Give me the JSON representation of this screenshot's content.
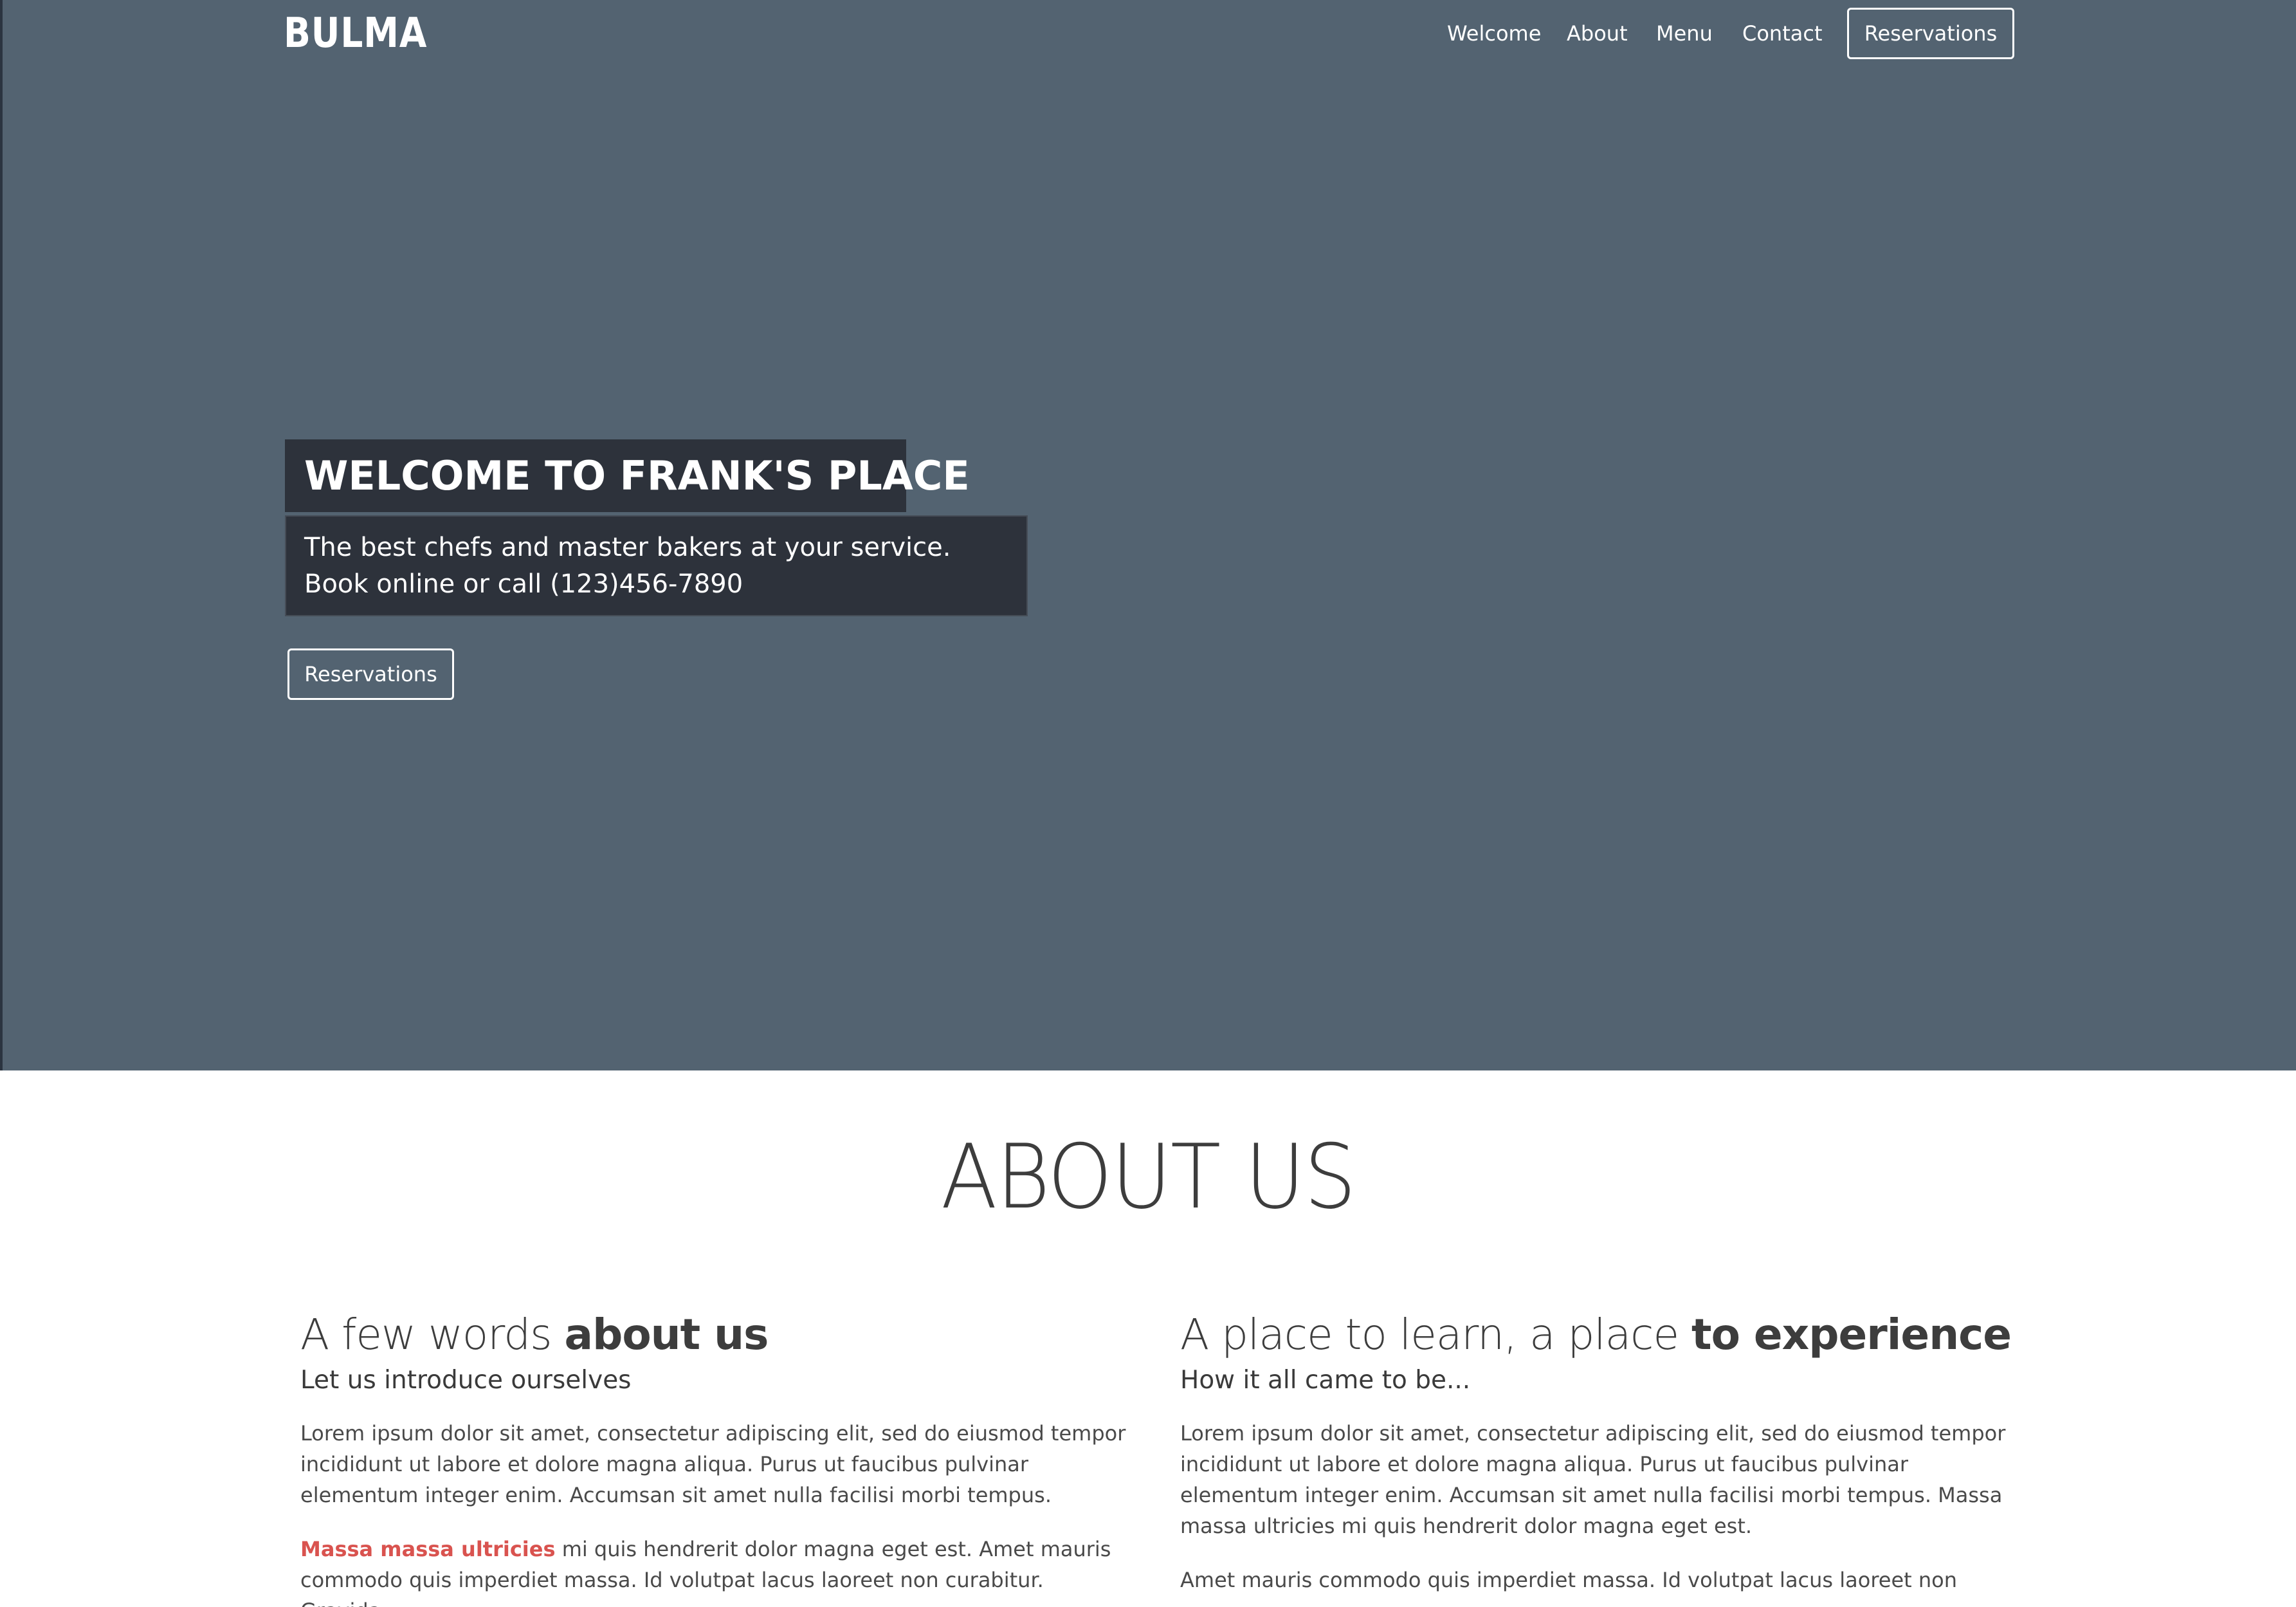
{
  "navbar": {
    "brand": "BULMA",
    "links": [
      "Welcome",
      "About",
      "Menu",
      "Contact"
    ],
    "reservations_label": "Reservations"
  },
  "hero": {
    "title": "WELCOME TO FRANK'S PLACE",
    "subtitle_line1": "The best chefs and master bakers at your service.",
    "subtitle_line2": "Book online or call (123)456-7890",
    "reservations_label": "Reservations",
    "background_color": "#536371",
    "box_color": "#2d323b"
  },
  "about": {
    "title": "ABOUT US",
    "left": {
      "heading_light": "A few words ",
      "heading_bold": "about us",
      "subheading": "Let us introduce ourselves",
      "paragraph1": "Lorem ipsum dolor sit amet, consectetur adipiscing elit, sed do eiusmod tempor incididunt ut labore et dolore magna aliqua. Purus ut faucibus pulvinar elementum integer enim. Accumsan sit amet nulla facilisi morbi tempus.",
      "paragraph2_link": "Massa massa ultricies",
      "paragraph2_rest": " mi quis hendrerit dolor magna eget est. Amet mauris commodo quis imperdiet massa. Id volutpat lacus laoreet non curabitur. Gravida"
    },
    "right": {
      "heading_light": "A place to learn, a place ",
      "heading_bold": "to experience",
      "subheading": "How it all came to be...",
      "paragraph1": "Lorem ipsum dolor sit amet, consectetur adipiscing elit, sed do eiusmod tempor incididunt ut labore et dolore magna aliqua. Purus ut faucibus pulvinar elementum integer enim. Accumsan sit amet nulla facilisi morbi tempus. Massa massa ultricies mi quis hendrerit dolor magna eget est.",
      "paragraph2": "Amet mauris commodo quis imperdiet massa. Id volutpat lacus laoreet non"
    },
    "accent_color": "#d9534f"
  }
}
